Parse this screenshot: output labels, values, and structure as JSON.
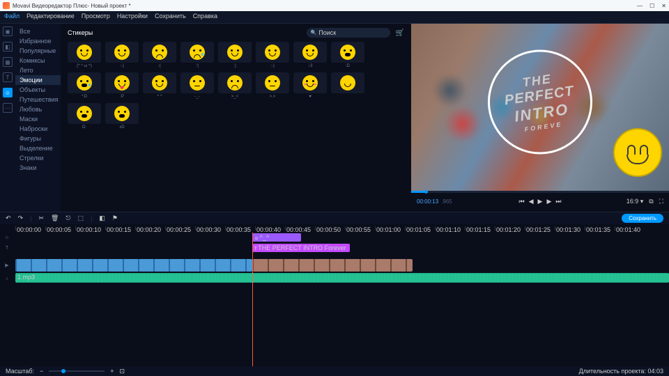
{
  "titlebar": {
    "app": "Movavi Видеоредактор Плюс",
    "project": "Новый проект *"
  },
  "menubar": [
    "Файл",
    "Редактирование",
    "Просмотр",
    "Настройки",
    "Сохранить",
    "Справка"
  ],
  "leftrail_icons": [
    "import-icon",
    "filters-icon",
    "transitions-icon",
    "titles-icon",
    "stickers-icon",
    "more-icon"
  ],
  "categories": [
    "Все",
    "Избранное",
    "Популярные",
    "Комиксы",
    "Лето",
    "Эмоции",
    "Объекты",
    "Путешествия",
    "Любовь",
    "Маски",
    "Наброски",
    "Фигуры",
    "Выделение",
    "Стрелки",
    "Знаки"
  ],
  "categories_selected": "Эмоции",
  "panel_title": "Стикеры",
  "search_placeholder": "Поиск",
  "stickers": [
    {
      "l": "(* ^ ω ^)"
    },
    {
      "l": ":-)"
    },
    {
      "l": ":("
    },
    {
      "l": ":'("
    },
    {
      "l": ":)"
    },
    {
      "l": ":-)"
    },
    {
      "l": ":-3"
    },
    {
      "l": ":D"
    },
    {
      "l": "*:D"
    },
    {
      "l": ":P"
    },
    {
      "l": "^ ^"
    },
    {
      "l": "-_-"
    },
    {
      "l": ">_<"
    },
    {
      "l": ">.>"
    },
    {
      "l": "♥"
    },
    {
      "l": ""
    },
    {
      "l": "D:"
    },
    {
      "l": "xD"
    }
  ],
  "preview": {
    "timecode": "00:00:13",
    "timecode_frac": ".965",
    "stamp": {
      "l1": "THE",
      "l2": "PERFECT",
      "l3": "INTRO",
      "l4": "FOREVE"
    },
    "aspect": "16:9 ▾"
  },
  "playback_buttons": [
    "⏮",
    "◀",
    "▶",
    "▶",
    "⏭"
  ],
  "toolbar": {
    "save": "Сохранить"
  },
  "ruler": [
    "00:00:00",
    "00:00:05",
    "00:00:10",
    "00:00:15",
    "00:00:20",
    "00:00:25",
    "00:00:30",
    "00:00:35",
    "00:00:40",
    "00:00:45",
    "00:00:50",
    "00:00:55",
    "00:01:00",
    "00:01:05",
    "00:01:10",
    "00:01:15",
    "00:01:20",
    "00:01:25",
    "00:01:30",
    "00:01:35",
    "00:01:40"
  ],
  "clips": {
    "sticker": "^_^",
    "title": "THE PERFECT INTRO Forever",
    "audio": "1.mp3"
  },
  "footer": {
    "zoom": "Масштаб:",
    "duration_label": "Длительность проекта:",
    "duration": "04:03"
  }
}
